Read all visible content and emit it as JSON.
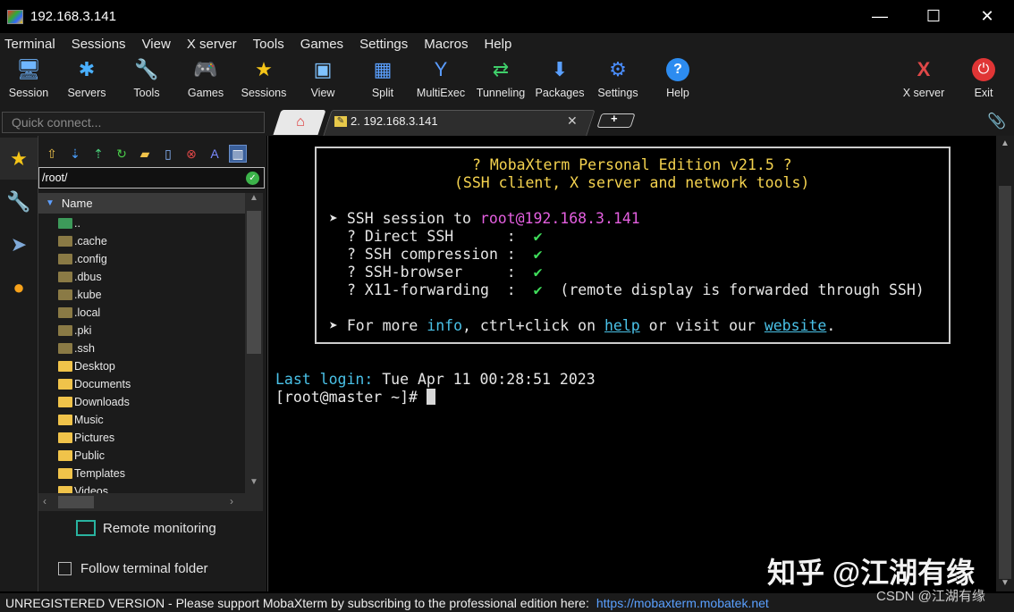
{
  "window": {
    "title": "192.168.3.141",
    "buttons": {
      "minimize": "—",
      "maximize": "☐",
      "close": "✕"
    }
  },
  "menu": [
    "Terminal",
    "Sessions",
    "View",
    "X server",
    "Tools",
    "Games",
    "Settings",
    "Macros",
    "Help"
  ],
  "toolbar": {
    "session": "Session",
    "servers": "Servers",
    "tools": "Tools",
    "games": "Games",
    "sessions": "Sessions",
    "view": "View",
    "split": "Split",
    "multiexec": "MultiExec",
    "tunneling": "Tunneling",
    "packages": "Packages",
    "settings": "Settings",
    "help": "Help",
    "xserver": "X server",
    "exit": "Exit"
  },
  "quick_connect": {
    "placeholder": "Quick connect..."
  },
  "tabs": {
    "session_label": "2. 192.168.3.141",
    "close": "✕",
    "new": "+"
  },
  "file_browser": {
    "path": "/root/",
    "column": "Name",
    "items": [
      "..",
      ".cache",
      ".config",
      ".dbus",
      ".kube",
      ".local",
      ".pki",
      ".ssh",
      "Desktop",
      "Documents",
      "Downloads",
      "Music",
      "Pictures",
      "Public",
      "Templates",
      "Videos"
    ],
    "remote_monitoring": "Remote monitoring",
    "follow_folder": "Follow terminal folder"
  },
  "terminal": {
    "banner_title": "? MobaXterm Personal Edition v21.5 ?",
    "banner_sub": "(SSH client, X server and network tools)",
    "ssh_prefix": "➤ SSH session to ",
    "ssh_target": "root@192.168.3.141",
    "opt1": "? Direct SSH      :  ",
    "opt2": "? SSH compression :  ",
    "opt3": "? SSH-browser     :  ",
    "opt4": "? X11-forwarding  :  ",
    "check": "✔",
    "x11_note": "  (remote display is forwarded through SSH)",
    "more_prefix": "➤ For more ",
    "more_info": "info",
    "more_mid": ", ctrl+click on ",
    "more_help": "help",
    "more_mid2": " or visit our ",
    "more_website": "website",
    "more_end": ".",
    "last_login_label": "Last login:",
    "last_login_value": " Tue Apr 11 00:28:51 2023",
    "prompt": "[root@master ~]# "
  },
  "status": {
    "text": "UNREGISTERED VERSION  -  Please support MobaXterm by subscribing to the professional edition here:",
    "url": "https://mobaxterm.mobatek.net"
  },
  "watermark": {
    "main": "知乎 @江湖有缘",
    "small": "CSDN @江湖有缘"
  },
  "colors": {
    "accent": "#5aa0ff",
    "prompt_green": "#3fdc5a",
    "banner_yellow": "#f5d34f",
    "user_magenta": "#e45fe0"
  }
}
